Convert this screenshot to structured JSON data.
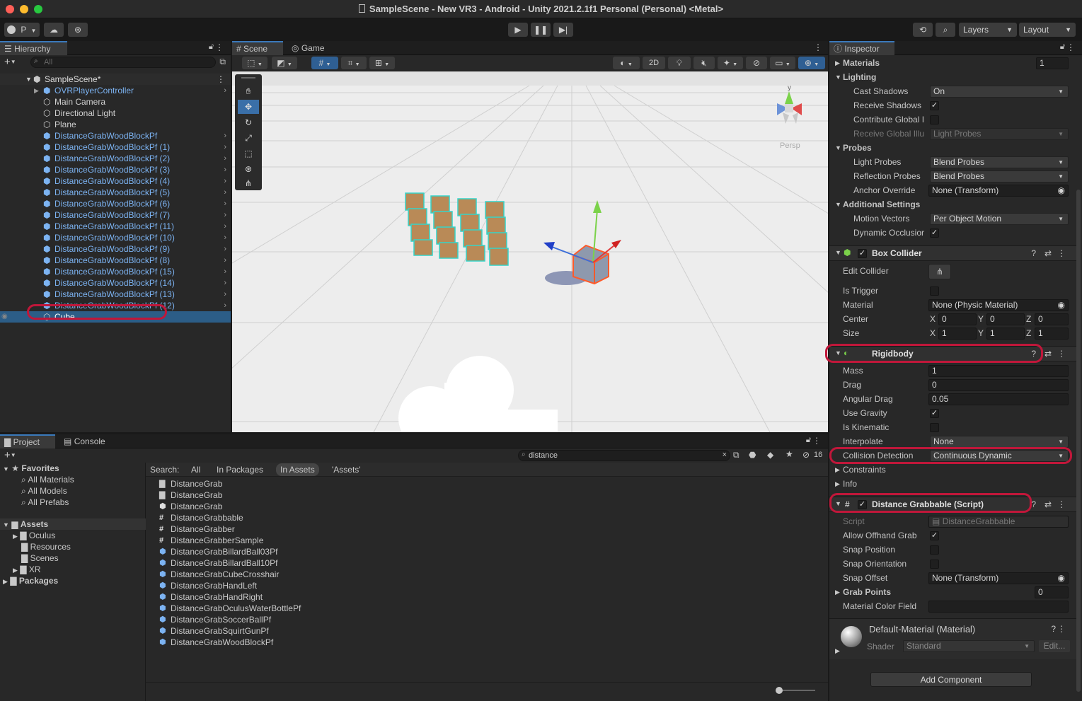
{
  "window": {
    "title": "SampleScene - New VR3 - Android - Unity 2021.2.1f1 Personal (Personal) <Metal>"
  },
  "toolbar": {
    "account": "P",
    "layers": "Layers",
    "layout": "Layout"
  },
  "hierarchy": {
    "tab": "Hierarchy",
    "search_placeholder": "All",
    "scene": "SampleScene*",
    "items": [
      {
        "label": "OVRPlayerController",
        "type": "prefab"
      },
      {
        "label": "Main Camera",
        "type": "object"
      },
      {
        "label": "Directional Light",
        "type": "object"
      },
      {
        "label": "Plane",
        "type": "object"
      },
      {
        "label": "DistanceGrabWoodBlockPf",
        "type": "prefab"
      },
      {
        "label": "DistanceGrabWoodBlockPf (1)",
        "type": "prefab"
      },
      {
        "label": "DistanceGrabWoodBlockPf (2)",
        "type": "prefab"
      },
      {
        "label": "DistanceGrabWoodBlockPf (3)",
        "type": "prefab"
      },
      {
        "label": "DistanceGrabWoodBlockPf (4)",
        "type": "prefab"
      },
      {
        "label": "DistanceGrabWoodBlockPf (5)",
        "type": "prefab"
      },
      {
        "label": "DistanceGrabWoodBlockPf (6)",
        "type": "prefab"
      },
      {
        "label": "DistanceGrabWoodBlockPf (7)",
        "type": "prefab"
      },
      {
        "label": "DistanceGrabWoodBlockPf (11)",
        "type": "prefab"
      },
      {
        "label": "DistanceGrabWoodBlockPf (10)",
        "type": "prefab"
      },
      {
        "label": "DistanceGrabWoodBlockPf (9)",
        "type": "prefab"
      },
      {
        "label": "DistanceGrabWoodBlockPf (8)",
        "type": "prefab"
      },
      {
        "label": "DistanceGrabWoodBlockPf (15)",
        "type": "prefab"
      },
      {
        "label": "DistanceGrabWoodBlockPf (14)",
        "type": "prefab"
      },
      {
        "label": "DistanceGrabWoodBlockPf (13)",
        "type": "prefab"
      },
      {
        "label": "DistanceGrabWoodBlockPf (12)",
        "type": "prefab"
      },
      {
        "label": "Cube",
        "type": "object",
        "selected": true
      }
    ]
  },
  "scene": {
    "tab_scene": "Scene",
    "tab_game": "Game",
    "mode_2d": "2D",
    "persp": "Persp",
    "gizmo_y": "y"
  },
  "inspector": {
    "tab": "Inspector",
    "materials": {
      "label": "Materials",
      "value": "1"
    },
    "lighting": {
      "label": "Lighting",
      "cast_shadows": {
        "label": "Cast Shadows",
        "value": "On"
      },
      "receive_shadows": {
        "label": "Receive Shadows",
        "checked": true
      },
      "contribute_gi": {
        "label": "Contribute Global I",
        "checked": false
      },
      "receive_gi": {
        "label": "Receive Global Illu",
        "value": "Light Probes"
      }
    },
    "probes": {
      "label": "Probes",
      "light_probes": {
        "label": "Light Probes",
        "value": "Blend Probes"
      },
      "reflection_probes": {
        "label": "Reflection Probes",
        "value": "Blend Probes"
      },
      "anchor_override": {
        "label": "Anchor Override",
        "value": "None (Transform)"
      }
    },
    "additional": {
      "label": "Additional Settings",
      "motion_vectors": {
        "label": "Motion Vectors",
        "value": "Per Object Motion"
      },
      "dynamic_occlusion": {
        "label": "Dynamic Occlusior",
        "checked": true
      }
    },
    "box_collider": {
      "title": "Box Collider",
      "edit_collider": "Edit Collider",
      "is_trigger": {
        "label": "Is Trigger",
        "checked": false
      },
      "material": {
        "label": "Material",
        "value": "None (Physic Material)"
      },
      "center": {
        "label": "Center",
        "x": "0",
        "y": "0",
        "z": "0"
      },
      "size": {
        "label": "Size",
        "x": "1",
        "y": "1",
        "z": "1"
      }
    },
    "rigidbody": {
      "title": "Rigidbody",
      "mass": {
        "label": "Mass",
        "value": "1"
      },
      "drag": {
        "label": "Drag",
        "value": "0"
      },
      "angular_drag": {
        "label": "Angular Drag",
        "value": "0.05"
      },
      "use_gravity": {
        "label": "Use Gravity",
        "checked": true
      },
      "is_kinematic": {
        "label": "Is Kinematic",
        "checked": false
      },
      "interpolate": {
        "label": "Interpolate",
        "value": "None"
      },
      "collision_detection": {
        "label": "Collision Detection",
        "value": "Continuous Dynamic"
      },
      "constraints": "Constraints",
      "info": "Info"
    },
    "distance_grabbable": {
      "title": "Distance Grabbable (Script)",
      "script": {
        "label": "Script",
        "value": "DistanceGrabbable"
      },
      "allow_offhand": {
        "label": "Allow Offhand Grab",
        "checked": true
      },
      "snap_position": {
        "label": "Snap Position",
        "checked": false
      },
      "snap_orientation": {
        "label": "Snap Orientation",
        "checked": false
      },
      "snap_offset": {
        "label": "Snap Offset",
        "value": "None (Transform)"
      },
      "grab_points": {
        "label": "Grab Points",
        "value": "0"
      },
      "material_color_field": {
        "label": "Material Color Field",
        "value": ""
      }
    },
    "material": {
      "title": "Default-Material (Material)",
      "shader_label": "Shader",
      "shader_value": "Standard",
      "edit": "Edit..."
    },
    "add_component": "Add Component"
  },
  "project": {
    "tab_project": "Project",
    "tab_console": "Console",
    "search_value": "distance",
    "result_count": "16",
    "search_label": "Search:",
    "scope_all": "All",
    "scope_packages": "In Packages",
    "scope_assets": "In Assets",
    "scope_folder": "'Assets'",
    "favorites": {
      "label": "Favorites",
      "items": [
        "All Materials",
        "All Models",
        "All Prefabs"
      ]
    },
    "assets": {
      "label": "Assets",
      "items": [
        "Oculus",
        "Resources",
        "Scenes",
        "XR"
      ]
    },
    "packages": "Packages",
    "results": [
      {
        "label": "DistanceGrab",
        "type": "folder"
      },
      {
        "label": "DistanceGrab",
        "type": "folder"
      },
      {
        "label": "DistanceGrab",
        "type": "scene"
      },
      {
        "label": "DistanceGrabbable",
        "type": "script"
      },
      {
        "label": "DistanceGrabber",
        "type": "script"
      },
      {
        "label": "DistanceGrabberSample",
        "type": "script"
      },
      {
        "label": "DistanceGrabBillardBall03Pf",
        "type": "prefab"
      },
      {
        "label": "DistanceGrabBillardBall10Pf",
        "type": "prefab"
      },
      {
        "label": "DistanceGrabCubeCrosshair",
        "type": "prefab"
      },
      {
        "label": "DistanceGrabHandLeft",
        "type": "prefab"
      },
      {
        "label": "DistanceGrabHandRight",
        "type": "prefab"
      },
      {
        "label": "DistanceGrabOculusWaterBottlePf",
        "type": "prefab"
      },
      {
        "label": "DistanceGrabSoccerBallPf",
        "type": "prefab"
      },
      {
        "label": "DistanceGrabSquirtGunPf",
        "type": "prefab"
      },
      {
        "label": "DistanceGrabWoodBlockPf",
        "type": "prefab"
      }
    ]
  },
  "colors": {
    "accent": "#3a79bb",
    "highlight": "#c0173a",
    "prefab_blue": "#7cb3f2"
  }
}
